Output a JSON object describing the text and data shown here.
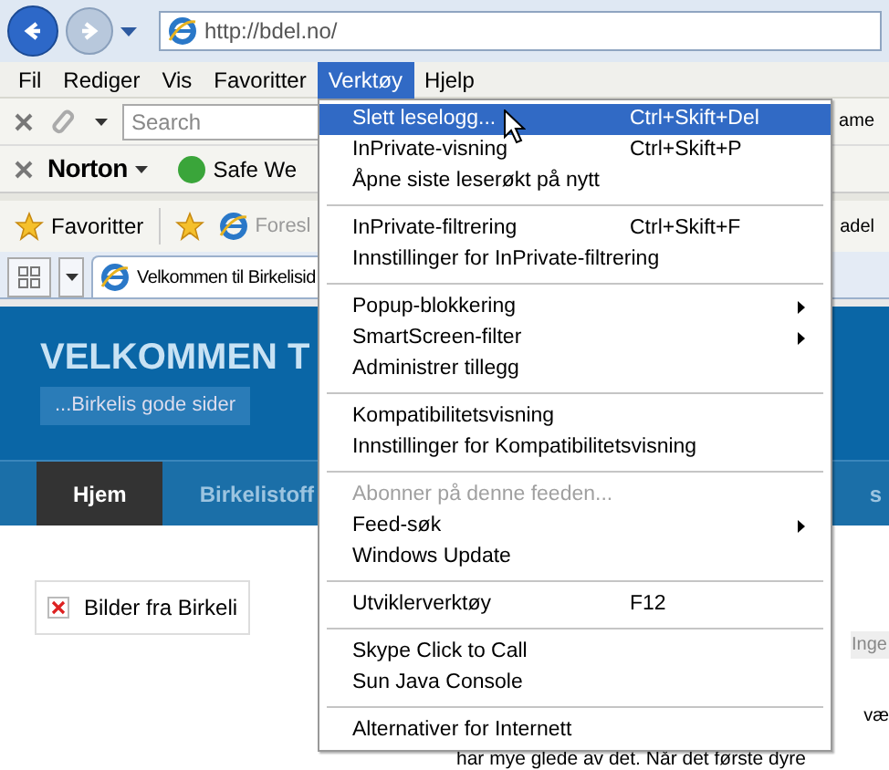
{
  "nav": {
    "address": "http://bdel.no/"
  },
  "menu_bar": [
    {
      "label": "Fil",
      "selected": false
    },
    {
      "label": "Rediger",
      "selected": false
    },
    {
      "label": "Vis",
      "selected": false
    },
    {
      "label": "Favoritter",
      "selected": false
    },
    {
      "label": "Verktøy",
      "selected": true
    },
    {
      "label": "Hjelp",
      "selected": false
    }
  ],
  "command_bar": {
    "search_placeholder": "Search",
    "edge_text": "ame"
  },
  "norton_bar": {
    "brand": "Norton",
    "safe_web": "Safe We"
  },
  "favorites_bar": {
    "favorites": "Favoritter",
    "suggested": "Foresl",
    "edge_text": "adel"
  },
  "tab": {
    "title": "Velkommen til Birkelisid"
  },
  "page": {
    "heading": "VELKOMMEN T",
    "tagline": "...Birkelis gode sider",
    "nav": [
      {
        "label": "Hjem",
        "selected": true
      },
      {
        "label": "Birkelistoff",
        "selected": false
      },
      {
        "label": "s",
        "selected": false
      }
    ],
    "image_alt": "Bilder fra Birkeli",
    "edge_texts": [
      "Inge",
      "væ"
    ],
    "body_line": "har mye glede av det. Når det første dyre"
  },
  "tools_menu": {
    "groups": [
      [
        {
          "label": "Slett leselogg...",
          "shortcut": "Ctrl+Skift+Del",
          "submenu": false,
          "disabled": false,
          "selected": true
        },
        {
          "label": "InPrivate-visning",
          "shortcut": "Ctrl+Skift+P",
          "submenu": false,
          "disabled": false,
          "selected": false
        },
        {
          "label": "Åpne siste leserøkt på nytt",
          "submenu": false,
          "disabled": false,
          "selected": false
        }
      ],
      [
        {
          "label": "InPrivate-filtrering",
          "shortcut": "Ctrl+Skift+F",
          "submenu": false,
          "disabled": false,
          "selected": false
        },
        {
          "label": "Innstillinger for InPrivate-filtrering",
          "submenu": false,
          "disabled": false,
          "selected": false
        }
      ],
      [
        {
          "label": "Popup-blokkering",
          "submenu": true,
          "disabled": false,
          "selected": false
        },
        {
          "label": "SmartScreen-filter",
          "submenu": true,
          "disabled": false,
          "selected": false
        },
        {
          "label": "Administrer tillegg",
          "submenu": false,
          "disabled": false,
          "selected": false
        }
      ],
      [
        {
          "label": "Kompatibilitetsvisning",
          "submenu": false,
          "disabled": false,
          "selected": false
        },
        {
          "label": "Innstillinger for Kompatibilitetsvisning",
          "submenu": false,
          "disabled": false,
          "selected": false
        }
      ],
      [
        {
          "label": "Abonner på denne feeden...",
          "submenu": false,
          "disabled": true,
          "selected": false
        },
        {
          "label": "Feed-søk",
          "submenu": true,
          "disabled": false,
          "selected": false
        },
        {
          "label": "Windows Update",
          "submenu": false,
          "disabled": false,
          "selected": false
        }
      ],
      [
        {
          "label": "Utviklerverktøy",
          "shortcut": "F12",
          "submenu": false,
          "disabled": false,
          "selected": false
        }
      ],
      [
        {
          "label": "Skype Click to Call",
          "submenu": false,
          "disabled": false,
          "selected": false
        },
        {
          "label": "Sun Java Console",
          "submenu": false,
          "disabled": false,
          "selected": false
        }
      ],
      [
        {
          "label": "Alternativer for Internett",
          "submenu": false,
          "disabled": false,
          "selected": false
        }
      ]
    ]
  }
}
